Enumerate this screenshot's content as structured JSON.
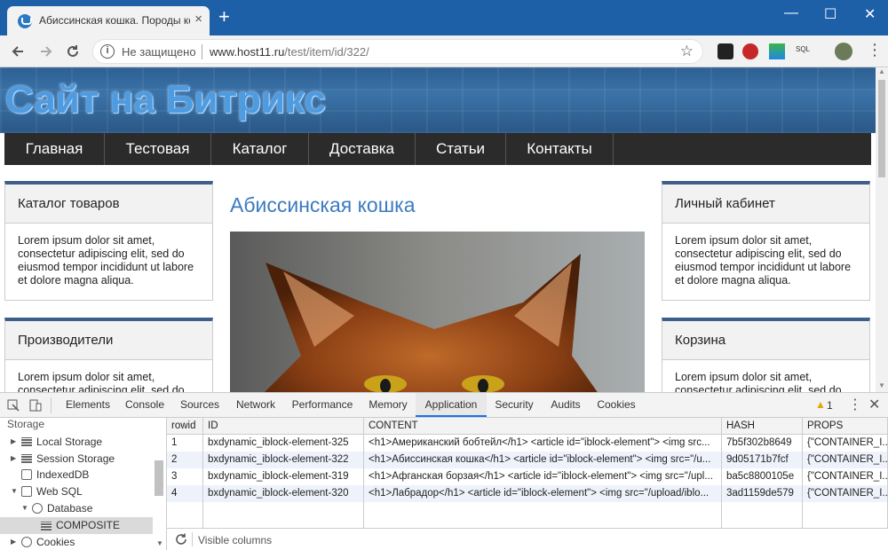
{
  "browser": {
    "tab_title": "Абиссинская кошка. Породы ко",
    "tab_close": "×",
    "new_tab": "+",
    "security_label": "Не защищено",
    "url_host": "www.host11.ru",
    "url_path": "/test/item/id/322/",
    "window_controls": {
      "minimize": "—",
      "maximize": "☐",
      "close": "✕"
    },
    "ext_sql_label": "SQL"
  },
  "site": {
    "title": "Сайт на Битрикс",
    "menu": [
      "Главная",
      "Тестовая",
      "Каталог",
      "Доставка",
      "Статьи",
      "Контакты"
    ],
    "left_boxes": [
      {
        "heading": "Каталог товаров",
        "text": "Lorem ipsum dolor sit amet, consectetur adipiscing elit, sed do eiusmod tempor incididunt ut labore et dolore magna aliqua."
      },
      {
        "heading": "Производители",
        "text": "Lorem ipsum dolor sit amet, consectetur adipiscing elit, sed do"
      }
    ],
    "right_boxes": [
      {
        "heading": "Личный кабинет",
        "text": "Lorem ipsum dolor sit amet, consectetur adipiscing elit, sed do eiusmod tempor incididunt ut labore et dolore magna aliqua."
      },
      {
        "heading": "Корзина",
        "text": "Lorem ipsum dolor sit amet, consectetur adipiscing elit, sed do"
      }
    ],
    "page_title": "Абиссинская кошка"
  },
  "devtools": {
    "tabs": [
      "Elements",
      "Console",
      "Sources",
      "Network",
      "Performance",
      "Memory",
      "Application",
      "Security",
      "Audits",
      "Cookies"
    ],
    "active_tab": "Application",
    "warning_count": "1",
    "sidebar": {
      "section": "Storage",
      "items": [
        "Local Storage",
        "Session Storage",
        "IndexedDB",
        "Web SQL",
        "Database",
        "COMPOSITE",
        "Cookies"
      ]
    },
    "table": {
      "columns": [
        "rowid",
        "ID",
        "CONTENT",
        "HASH",
        "PROPS"
      ],
      "rows": [
        [
          "1",
          "bxdynamic_iblock-element-325",
          "<h1>Американский бобтейл</h1>  <article id=\"iblock-element\">  <img src...",
          "7b5f302b8649",
          "{\"CONTAINER_I..."
        ],
        [
          "2",
          "bxdynamic_iblock-element-322",
          "<h1>Абиссинская кошка</h1>  <article id=\"iblock-element\">  <img src=\"/u...",
          "9d05171b7fcf",
          "{\"CONTAINER_I..."
        ],
        [
          "3",
          "bxdynamic_iblock-element-319",
          "<h1>Афганская борзая</h1>  <article id=\"iblock-element\">  <img src=\"/upl...",
          "ba5c8800105e",
          "{\"CONTAINER_I..."
        ],
        [
          "4",
          "bxdynamic_iblock-element-320",
          "<h1>Лабрадор</h1>  <article id=\"iblock-element\">  <img src=\"/upload/iblo...",
          "3ad1159de579",
          "{\"CONTAINER_I..."
        ]
      ]
    },
    "footer_label": "Visible columns",
    "colors": {
      "accent": "#1a73e8",
      "row_alt": "#eef3fb"
    }
  }
}
